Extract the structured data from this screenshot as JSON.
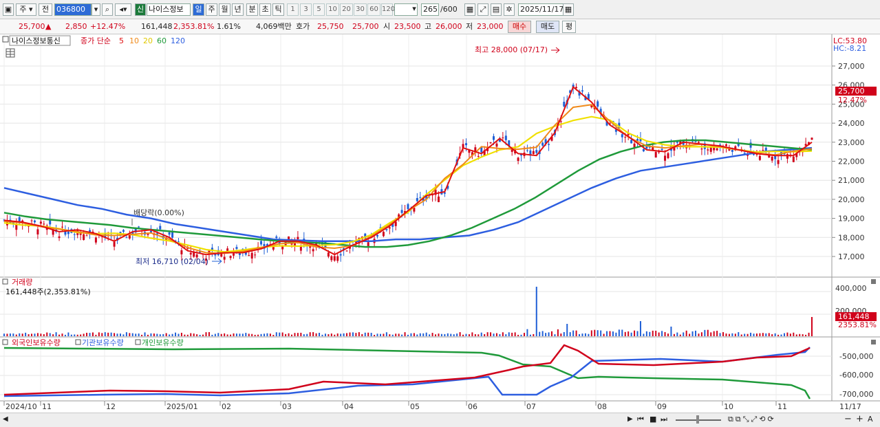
{
  "toolbar": {
    "market": "주",
    "prev_label": "전",
    "code": "036800",
    "shin": "신",
    "stock_name": "나이스정보",
    "periods": [
      "일",
      "주",
      "월",
      "년",
      "분",
      "초",
      "틱"
    ],
    "numbers": [
      "1",
      "3",
      "5",
      "10",
      "20",
      "30",
      "60",
      "120"
    ],
    "count": "265",
    "count_total": "/600",
    "date": "2025/11/17"
  },
  "quote": {
    "price": "25,700",
    "arrow": "▲",
    "change": "2,850",
    "pct": "+12.47%",
    "volume": "161,448",
    "vol_pct": "2,353.81%",
    "turnover": "1.61%",
    "amount": "4,069백만",
    "bid_label": "호가",
    "bid_price": "25,750",
    "open_price": "25,700",
    "open_label": "시",
    "open_val": "23,500",
    "high_label": "고",
    "high_val": "26,000",
    "low_label": "저",
    "low_val": "23,000",
    "buy": "매수",
    "sell": "매도",
    "avg": "평"
  },
  "legend": {
    "name": "나이스정보통신",
    "ma_label": "종가 단순",
    "ma": [
      "5",
      "10",
      "20",
      "60",
      "120"
    ]
  },
  "annotations": {
    "high": "최고 28,000 (07/17)",
    "low": "최저 16,710 (02/04)",
    "dividend": "배당락(0.00%)"
  },
  "volume_panel": {
    "title": "거래량",
    "info": "161,448주(2,353.81%)",
    "ticks": [
      "400,000",
      "200,000"
    ],
    "tag_value": "161,448",
    "tag_pct": "2353.81%"
  },
  "holding_panel": {
    "titles": [
      "외국인보유수량",
      "기관보유수량",
      "개인보유수량"
    ],
    "ticks": [
      "-500,000",
      "-600,000",
      "-700,000"
    ]
  },
  "price_axis": {
    "lc": "LC:53.80",
    "hc": "HC:-8.21",
    "ticks": [
      "27,000",
      "26,000",
      "25,000",
      "24,000",
      "23,000",
      "22,000",
      "21,000",
      "20,000",
      "19,000",
      "18,000",
      "17,000"
    ],
    "tag_price": "25,700",
    "tag_pct": "12.47%"
  },
  "date_axis": {
    "labels": [
      "2024/10",
      "11",
      "12",
      "2025/01",
      "02",
      "03",
      "04",
      "05",
      "06",
      "07",
      "08",
      "09",
      "10",
      "11"
    ],
    "end_label": "11/17"
  },
  "colors": {
    "up": "#d0021b",
    "down": "#1f5fd6",
    "ma5": "#e01010",
    "ma10": "#f08a1a",
    "ma20": "#f0e000",
    "ma60": "#1f9a3a",
    "ma120": "#2d5ee0"
  },
  "icons": [
    "layout-icon",
    "search-icon",
    "speaker-icon",
    "grid-tool-icon",
    "chart-tool-icon",
    "save-icon",
    "gear-icon",
    "calendar-icon",
    "table-icon",
    "zoom-out-icon",
    "zoom-in-icon"
  ],
  "chart_data": {
    "type": "candlestick",
    "series": [
      {
        "name": "종가 단순 5",
        "values": [
          18.9,
          18.8,
          18.6,
          18.3,
          18.4,
          18.2,
          17.8,
          18.3,
          18.4,
          18.0,
          17.3,
          17.1,
          17.2,
          17.2,
          17.4,
          17.8,
          17.8,
          17.6,
          17.1,
          17.6,
          18.0,
          18.6,
          19.4,
          20.2,
          20.4,
          22.7,
          22.4,
          23.2,
          22.4,
          22.3,
          23.5,
          25.9,
          25.1,
          23.9,
          23.3,
          22.6,
          22.5,
          23.0,
          22.9,
          22.8,
          22.6,
          22.4,
          22.3,
          22.3,
          23.0
        ]
      },
      {
        "name": "종가 단순 120",
        "values": [
          20.6,
          20.3,
          20.0,
          19.7,
          19.5,
          19.2,
          19.0,
          18.7,
          18.5,
          18.3,
          18.1,
          17.9,
          17.85,
          17.8,
          17.8,
          17.8,
          17.9,
          17.9,
          18.0,
          18.1,
          18.4,
          18.8,
          19.4,
          20.0,
          20.6,
          21.1,
          21.5,
          21.7,
          21.9,
          22.1,
          22.3,
          22.5,
          22.6,
          22.7
        ]
      }
    ],
    "ylim": [
      16.5,
      28.5
    ]
  }
}
